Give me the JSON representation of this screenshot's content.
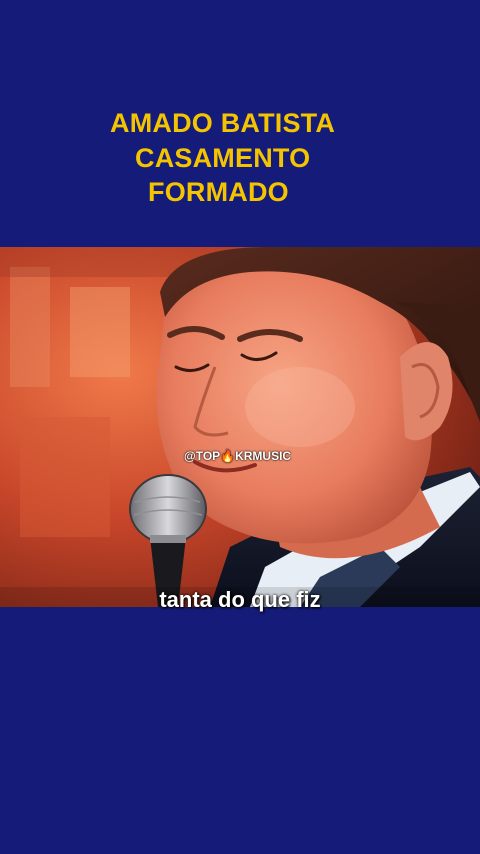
{
  "title": {
    "line1": "AMADO BATISTA",
    "line2": "CASAMENTO",
    "line3": "FORMADO"
  },
  "video": {
    "watermark": "@TOP🔥KRMUSIC",
    "caption": "tanta do que fiz"
  },
  "colors": {
    "background": "#151b78",
    "title": "#f5c400",
    "caption": "#ffffff"
  }
}
